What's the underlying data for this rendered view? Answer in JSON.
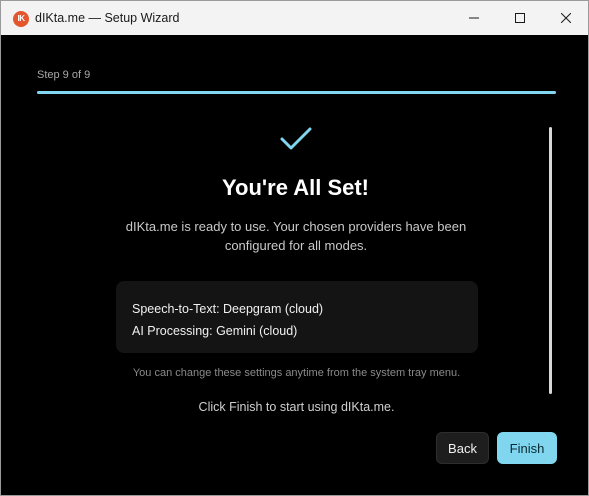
{
  "window": {
    "title": "dIKta.me — Setup Wizard",
    "app_icon_text": "IK"
  },
  "wizard": {
    "step_label": "Step 9 of 9",
    "progress_fraction": 1.0
  },
  "content": {
    "heading": "You're All Set!",
    "description": "dIKta.me is ready to use. Your chosen providers have been configured for all modes.",
    "summary": {
      "speech_to_text": "Speech-to-Text: Deepgram (cloud)",
      "ai_processing": "AI Processing: Gemini (cloud)"
    },
    "hint": "You can change these settings anytime from the system tray menu.",
    "finish_note": "Click Finish to start using dIKta.me."
  },
  "buttons": {
    "back": "Back",
    "finish": "Finish"
  },
  "icons": {
    "check": "check-icon",
    "minimize": "minimize-icon",
    "maximize": "maximize-icon",
    "close": "close-icon"
  },
  "colors": {
    "accent": "#7fd6ee",
    "background": "#000000",
    "app_icon": "#e4572e"
  }
}
